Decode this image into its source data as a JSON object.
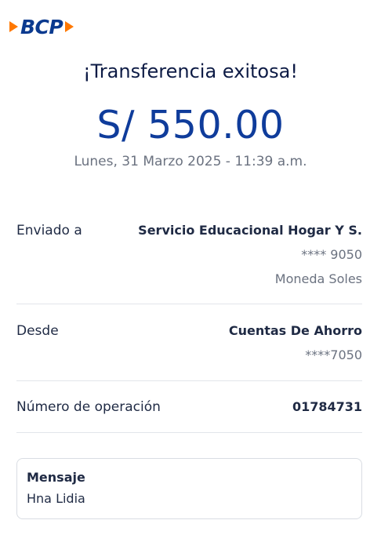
{
  "brand": {
    "name": "BCP",
    "accent": "#ff7800",
    "primary": "#0b3a8f"
  },
  "title": "¡Transferencia exitosa!",
  "amount": "S/ 550.00",
  "datetime": "Lunes, 31 Marzo 2025 - 11:39 a.m.",
  "details": {
    "recipient": {
      "label": "Enviado a",
      "name": "Servicio Educacional Hogar Y S.",
      "account": "**** 9050",
      "currency": "Moneda Soles"
    },
    "source": {
      "label": "Desde",
      "account_type": "Cuentas De Ahorro",
      "account": "****7050"
    },
    "operation": {
      "label": "Número de operación",
      "number": "01784731"
    }
  },
  "message": {
    "title": "Mensaje",
    "text": "Hna Lidia"
  }
}
